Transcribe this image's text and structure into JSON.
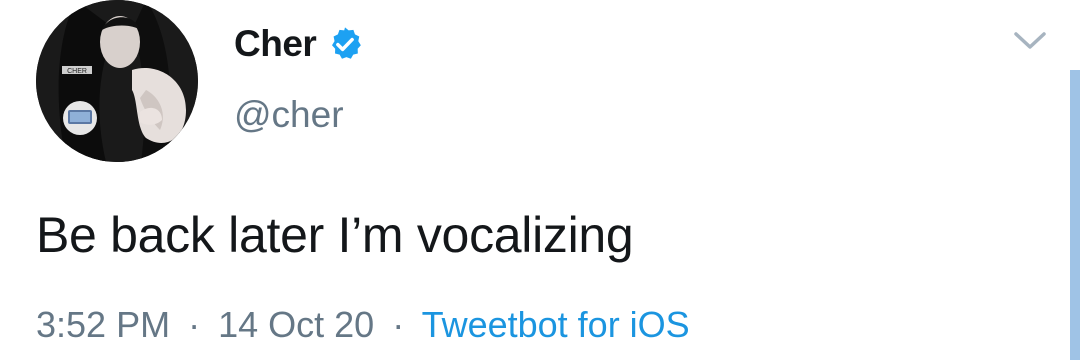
{
  "author": {
    "display_name": "Cher",
    "handle": "@cher",
    "verified": true,
    "avatar_icon": "profile-photo-icon",
    "avatar_badge_text": "CHER"
  },
  "tweet": {
    "text": "Be back later I’m vocalizing",
    "time": "3:52 PM",
    "separator": "·",
    "date": "14 Oct 20",
    "source": "Tweetbot for iOS"
  },
  "icons": {
    "verified": "verified-badge-icon",
    "menu": "chevron-down-icon"
  },
  "colors": {
    "text": "#14171a",
    "secondary": "#657786",
    "link": "#1b95e0",
    "verified": "#1da1f2",
    "scroll_indicator": "#9fc3e6"
  }
}
